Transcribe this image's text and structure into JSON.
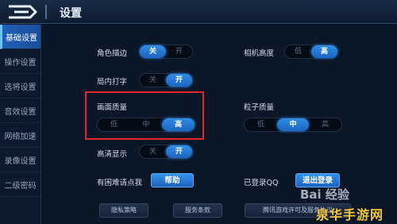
{
  "header": {
    "title": "设置"
  },
  "sidebar": {
    "items": [
      {
        "label": "基础设置",
        "active": true
      },
      {
        "label": "操作设置"
      },
      {
        "label": "选将设置"
      },
      {
        "label": "音效设置"
      },
      {
        "label": "网络加速"
      },
      {
        "label": "录像设置"
      },
      {
        "label": "二级密码"
      }
    ]
  },
  "settings": {
    "outline": {
      "label": "角色描边",
      "options": [
        "关",
        "开"
      ],
      "selected": "关"
    },
    "camera": {
      "label": "相机高度",
      "options": [
        "低",
        "高"
      ],
      "selected": "高"
    },
    "typing": {
      "label": "局内打字",
      "options": [
        "关",
        "开"
      ],
      "selected": "开"
    },
    "quality": {
      "label": "画面质量",
      "options": [
        "低",
        "中",
        "高"
      ],
      "selected": "高"
    },
    "particles": {
      "label": "粒子质量",
      "options": [
        "低",
        "中",
        "高"
      ],
      "selected": "中"
    },
    "hd": {
      "label": "高清显示",
      "options": [
        "关",
        "开"
      ],
      "selected": "开"
    },
    "help": {
      "label": "有困难请点我",
      "button": "帮助"
    },
    "account": {
      "label": "已登录QQ",
      "button": "退出登录"
    }
  },
  "footer": {
    "privacy": "隐私策略",
    "terms": "服务条款",
    "license": "腾讯游戏许可及服务协议"
  },
  "watermarks": {
    "baidu": "Bai 经验",
    "site": "泉华手游网"
  },
  "colors": {
    "accent": "#1e64c0",
    "highlight_border": "#e0262b",
    "site_watermark": "#f0c53a"
  }
}
